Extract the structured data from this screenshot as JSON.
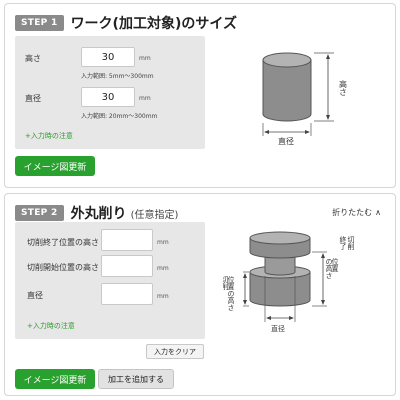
{
  "step1": {
    "badge": "STEP 1",
    "title": "ワーク(加工対象)のサイズ",
    "height_label": "高さ",
    "height_value": "30",
    "height_unit": "mm",
    "height_range": "入力範囲: 5mm〜300mm",
    "diameter_label": "直径",
    "diameter_value": "30",
    "diameter_unit": "mm",
    "diameter_range": "入力範囲: 20mm〜300mm",
    "note_link": "+入力時の注意",
    "update_button": "イメージ図更新",
    "diagram": {
      "height_label": "高さ",
      "diameter_label": "直径"
    }
  },
  "step2": {
    "badge": "STEP 2",
    "title": "外丸削り",
    "subtitle": "(任意指定)",
    "collapse_label": "折りたたむ",
    "end_label": "切削終了位置の高さ",
    "end_value": "",
    "end_unit": "mm",
    "start_label": "切削開始位置の高さ",
    "start_value": "",
    "start_unit": "mm",
    "diameter_label": "直径",
    "diameter_value": "",
    "diameter_unit": "mm",
    "note_link": "+入力時の注意",
    "clear_button": "入力をクリア",
    "update_button": "イメージ図更新",
    "add_button": "加工を追加する",
    "diagram": {
      "end_label_col1": "切削",
      "end_label_col2": "終了",
      "end_label_col3": "位置",
      "end_label_col4": "の高さ",
      "start_label_col1": "切削",
      "start_label_col2": "開始",
      "start_label_col3": "位置",
      "start_label_col4": "の高さ",
      "diameter_label": "直径"
    }
  }
}
